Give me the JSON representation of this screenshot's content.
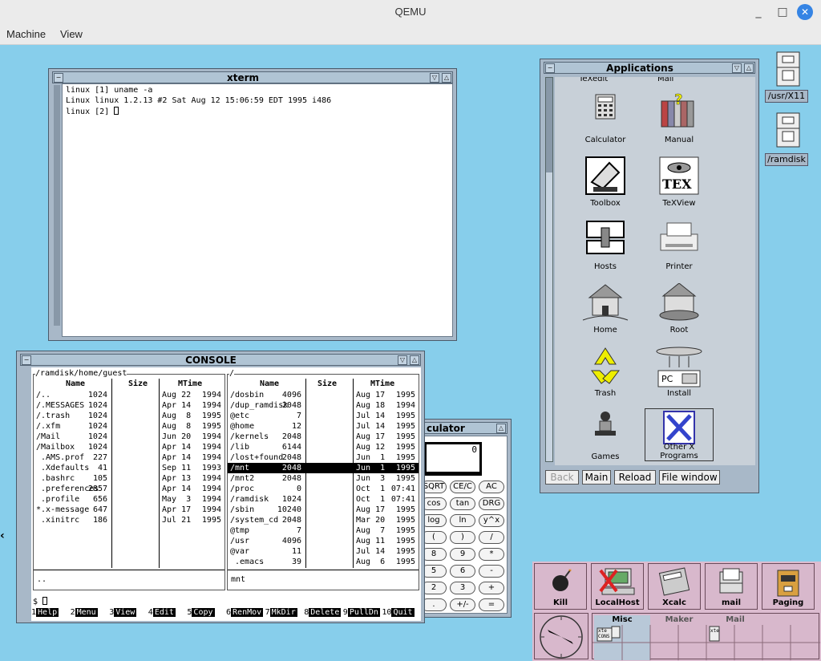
{
  "host": {
    "title": "QEMU",
    "minimize": "_",
    "maximize": "□",
    "close": "✕",
    "menu": [
      "Machine",
      "View"
    ]
  },
  "xterm": {
    "title": "xterm",
    "lines": [
      "linux [1] uname -a",
      "Linux linux 1.2.13 #2 Sat Aug 12 15:06:59 EDT 1995 i486",
      "linux [2] "
    ]
  },
  "console": {
    "title": "CONSOLE",
    "left_path": "/ramdisk/home/guest",
    "right_path": "/",
    "headers": {
      "name": "Name",
      "size": "Size",
      "mtime": "MTime"
    },
    "left_rows": [
      {
        "name": "/..",
        "size": "1024",
        "date": "Aug 22",
        "year": "1994"
      },
      {
        "name": "/.MESSAGES",
        "size": "1024",
        "date": "Apr 14",
        "year": "1994"
      },
      {
        "name": "/.trash",
        "size": "1024",
        "date": "Aug  8",
        "year": "1995"
      },
      {
        "name": "/.xfm",
        "size": "1024",
        "date": "Aug  8",
        "year": "1995"
      },
      {
        "name": "/Mail",
        "size": "1024",
        "date": "Jun 20",
        "year": "1994"
      },
      {
        "name": "/Mailbox",
        "size": "1024",
        "date": "Apr 14",
        "year": "1994"
      },
      {
        "name": " .AMS.prof",
        "size": "227",
        "date": "Apr 14",
        "year": "1994"
      },
      {
        "name": " .Xdefaults",
        "size": "41",
        "date": "Sep 11",
        "year": "1993"
      },
      {
        "name": " .bashrc",
        "size": "105",
        "date": "Apr 13",
        "year": "1994"
      },
      {
        "name": " .preferences",
        "size": "2857",
        "date": "Apr 14",
        "year": "1994"
      },
      {
        "name": " .profile",
        "size": "656",
        "date": "May  3",
        "year": "1994"
      },
      {
        "name": "*.x-message",
        "size": "647",
        "date": "Apr 17",
        "year": "1994"
      },
      {
        "name": " .xinitrc",
        "size": "186",
        "date": "Jul 21",
        "year": "1995"
      }
    ],
    "right_rows": [
      {
        "name": "/dosbin",
        "size": "4096",
        "date": "Aug 17",
        "year": "1995"
      },
      {
        "name": "/dup_ramdisk",
        "size": "2048",
        "date": "Aug 18",
        "year": "1994"
      },
      {
        "name": "@etc",
        "size": "7",
        "date": "Jul 14",
        "year": "1995"
      },
      {
        "name": "@home",
        "size": "12",
        "date": "Jul 14",
        "year": "1995"
      },
      {
        "name": "/kernels",
        "size": "2048",
        "date": "Aug 17",
        "year": "1995"
      },
      {
        "name": "/lib",
        "size": "6144",
        "date": "Aug 12",
        "year": "1995"
      },
      {
        "name": "/lost+found",
        "size": "2048",
        "date": "Jun  1",
        "year": "1995"
      },
      {
        "name": "/mnt",
        "size": "2048",
        "date": "Jun  1",
        "year": "1995"
      },
      {
        "name": "/mnt2",
        "size": "2048",
        "date": "Jun  3",
        "year": "1995"
      },
      {
        "name": "/proc",
        "size": "0",
        "date": "Oct  1",
        "year": "07:41"
      },
      {
        "name": "/ramdisk",
        "size": "1024",
        "date": "Oct  1",
        "year": "07:41"
      },
      {
        "name": "/sbin",
        "size": "10240",
        "date": "Aug 17",
        "year": "1995"
      },
      {
        "name": "/system_cd",
        "size": "2048",
        "date": "Mar 20",
        "year": "1995"
      },
      {
        "name": "@tmp",
        "size": "7",
        "date": "Aug  7",
        "year": "1995"
      },
      {
        "name": "/usr",
        "size": "4096",
        "date": "Aug 11",
        "year": "1995"
      },
      {
        "name": "@var",
        "size": "11",
        "date": "Jul 14",
        "year": "1995"
      },
      {
        "name": " .emacs",
        "size": "39",
        "date": "Aug  6",
        "year": "1995"
      }
    ],
    "left_status": "..",
    "right_status": "mnt",
    "prompt": "$ ",
    "fkeys": [
      {
        "num": "1",
        "label": "Help"
      },
      {
        "num": "2",
        "label": "Menu"
      },
      {
        "num": "3",
        "label": "View"
      },
      {
        "num": "4",
        "label": "Edit"
      },
      {
        "num": "5",
        "label": "Copy"
      },
      {
        "num": "6",
        "label": "RenMov"
      },
      {
        "num": "7",
        "label": "MkDir"
      },
      {
        "num": "8",
        "label": "Delete"
      },
      {
        "num": "9",
        "label": "PullDn"
      },
      {
        "num": "10",
        "label": "Quit"
      }
    ]
  },
  "calculator": {
    "title": "culator",
    "display": "0",
    "buttons": [
      "SQRT",
      "CE/C",
      "AC",
      "cos",
      "tan",
      "DRG",
      "log",
      "ln",
      "y^x",
      "(",
      ")",
      "/",
      "8",
      "9",
      "*",
      "5",
      "6",
      "-",
      "2",
      "3",
      "+",
      ".",
      "+/-",
      "="
    ]
  },
  "applications": {
    "title": "Applications",
    "partial_labels": [
      "TeXedit",
      "Mail"
    ],
    "items": [
      {
        "label": "Calculator",
        "icon": "calculator-icon"
      },
      {
        "label": "Manual",
        "icon": "manual-icon"
      },
      {
        "label": "Toolbox",
        "icon": "toolbox-icon"
      },
      {
        "label": "TeXView",
        "icon": "texview-icon"
      },
      {
        "label": "Hosts",
        "icon": "hosts-icon"
      },
      {
        "label": "Printer",
        "icon": "printer-icon"
      },
      {
        "label": "Home",
        "icon": "home-icon"
      },
      {
        "label": "Root",
        "icon": "root-icon"
      },
      {
        "label": "Trash",
        "icon": "trash-icon"
      },
      {
        "label": "Install",
        "icon": "install-icon"
      },
      {
        "label": "Games",
        "icon": "games-icon"
      },
      {
        "label": "Other X Programs",
        "icon": "x-programs-icon"
      }
    ],
    "buttons": [
      "Back",
      "Main",
      "Reload",
      "File window"
    ],
    "install_pc": "PC"
  },
  "desktop": {
    "icons": [
      "/usr/X11",
      "/ramdisk"
    ]
  },
  "dock": {
    "buttons": [
      "Kill",
      "LocalHost",
      "Xcalc",
      "mail",
      "Paging"
    ],
    "desk_tabs": [
      "Misc",
      "Maker",
      "Mail"
    ],
    "mini_labels": [
      "xte",
      "CONS",
      "xte"
    ]
  }
}
